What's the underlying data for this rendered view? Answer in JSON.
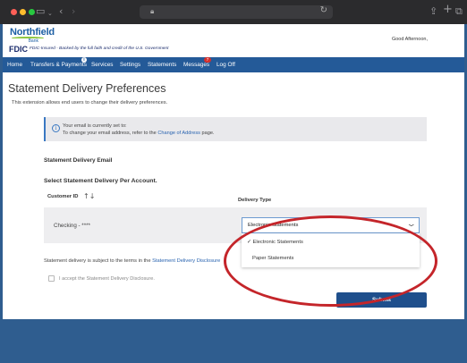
{
  "header": {
    "logo_name": "Northfield",
    "logo_sub": "Bank",
    "fdic_label": "FDIC",
    "fdic_tagline": "FDIC-Insured - Backed by the full faith and credit of the U.S. Government",
    "greeting": "Good Afternoon,"
  },
  "nav": {
    "items": [
      "Home",
      "Transfers & Payments",
      "Services",
      "Settings",
      "Statements",
      "Messages",
      "Log Off"
    ],
    "messages_badge": "7",
    "info_badge": "i"
  },
  "page": {
    "title": "Statement Delivery Preferences",
    "subtitle": "This extension allows end users to change their delivery preferences."
  },
  "info": {
    "line1": "Your email is currently set to:",
    "line2_prefix": "To change your email address, refer to the ",
    "line2_link": "Change of Address",
    "line2_suffix": " page."
  },
  "sections": {
    "email": "Statement Delivery Email",
    "select": "Select Statement Delivery Per Account."
  },
  "table": {
    "col_customer_id": "Customer ID",
    "col_delivery_type": "Delivery Type",
    "rows": [
      {
        "account": "Checking - ****",
        "delivery": "Electronic Statements"
      }
    ]
  },
  "dropdown": {
    "options": [
      "Electronic Statements",
      "Paper Statements"
    ],
    "selected_mark": "✓"
  },
  "terms": {
    "prefix": "Statement delivery is subject to the terms in the ",
    "link": "Statement Delivery Disclosure"
  },
  "accept_label": "I accept the Statement Delivery Disclosure.",
  "submit_label": "Submit",
  "colors": {
    "nav_bg": "#245a98",
    "submit_bg": "#1f4f8c",
    "annotation_red": "#c4252a",
    "link": "#2a64b0"
  }
}
